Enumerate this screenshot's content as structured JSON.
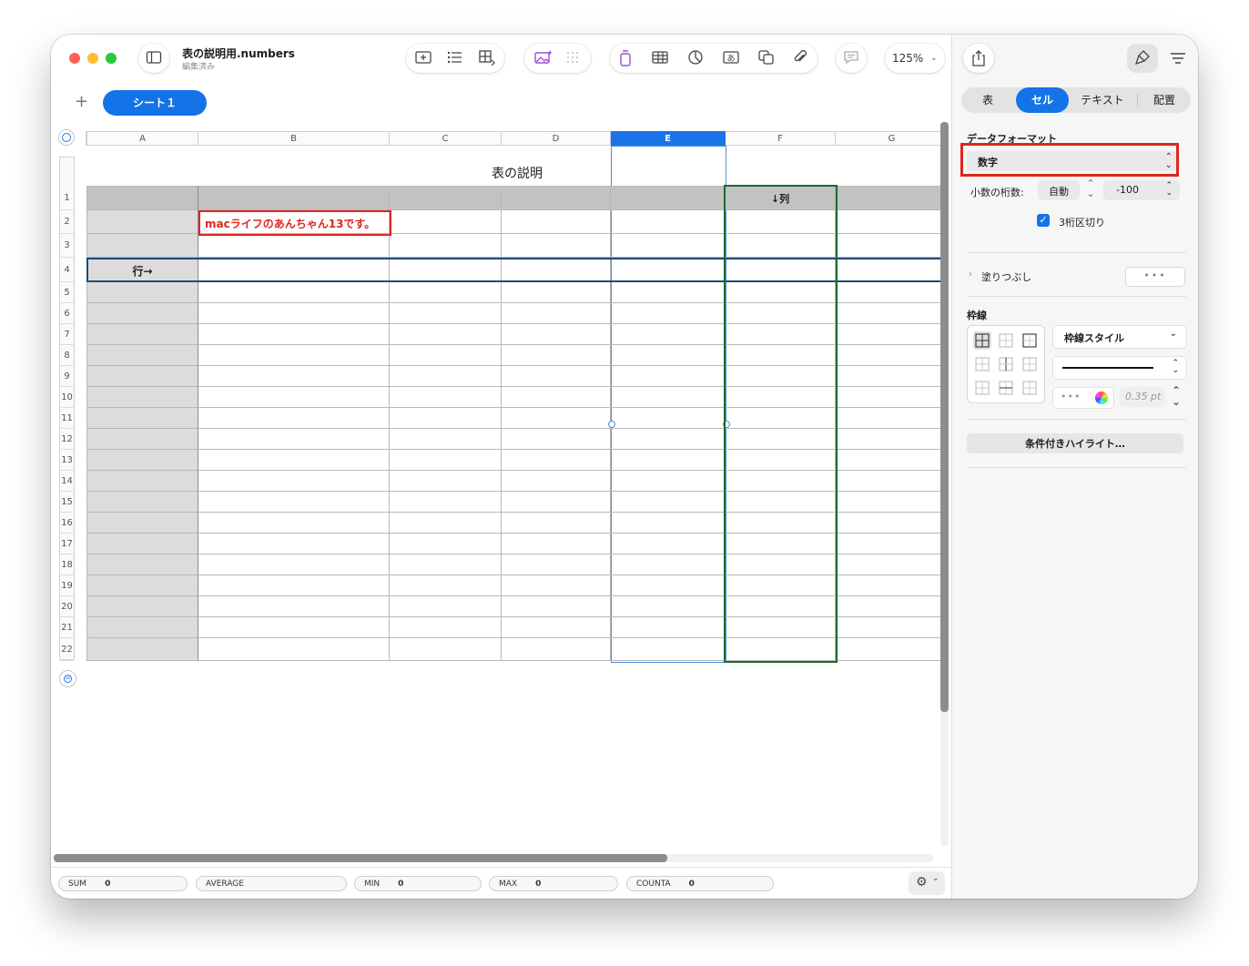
{
  "window": {
    "doc_title": "表の説明用.numbers",
    "doc_subtitle": "編集済み",
    "zoom": "125%"
  },
  "toolbar": {
    "groups": [
      [
        "insert-icon",
        "list-icon",
        "table-add-icon"
      ],
      [
        "image-gen-icon",
        "grid-icon"
      ],
      [
        "text-icon",
        "table-icon",
        "chart-icon",
        "textbox-icon",
        "shape-icon",
        "attachment-icon"
      ],
      [
        "comment-icon"
      ]
    ]
  },
  "sheet": {
    "tab": "シート１"
  },
  "grid": {
    "columns": [
      "A",
      "B",
      "C",
      "D",
      "E",
      "F",
      "G"
    ],
    "selected_column": "E",
    "rows": [
      "1",
      "2",
      "3",
      "4",
      "5",
      "6",
      "7",
      "8",
      "9",
      "10",
      "11",
      "12",
      "13",
      "14",
      "15",
      "16",
      "17",
      "18",
      "19",
      "20",
      "21",
      "22"
    ]
  },
  "table": {
    "title": "表の説明",
    "cells": {
      "B2": "macライフのあんちゃん13です。",
      "A4": "行→",
      "F1": "↓列"
    }
  },
  "status_bar": [
    {
      "label": "SUM",
      "value": "0"
    },
    {
      "label": "AVERAGE",
      "value": ""
    },
    {
      "label": "MIN",
      "value": "0"
    },
    {
      "label": "MAX",
      "value": "0"
    },
    {
      "label": "COUNTA",
      "value": "0"
    }
  ],
  "inspector": {
    "tabs": [
      "表",
      "セル",
      "テキスト",
      "配置"
    ],
    "active_tab": "セル",
    "data_format_label": "データフォーマット",
    "data_format_value": "数字",
    "decimals_label": "小数の桁数:",
    "decimals_value": "自動",
    "negative_format": "-100",
    "thousands_label": "3桁区切り",
    "thousands_checked": true,
    "fill_label": "塗りつぶし",
    "border_label": "枠線",
    "border_style": "枠線スタイル",
    "border_width": "0.35 pt",
    "conditional_label": "条件付きハイライト…"
  },
  "colors": {
    "accent": "#1473e6",
    "highlight_red": "#e0261b",
    "row_outline": "#1e4a7a",
    "column_outline": "#1a6b2e"
  }
}
